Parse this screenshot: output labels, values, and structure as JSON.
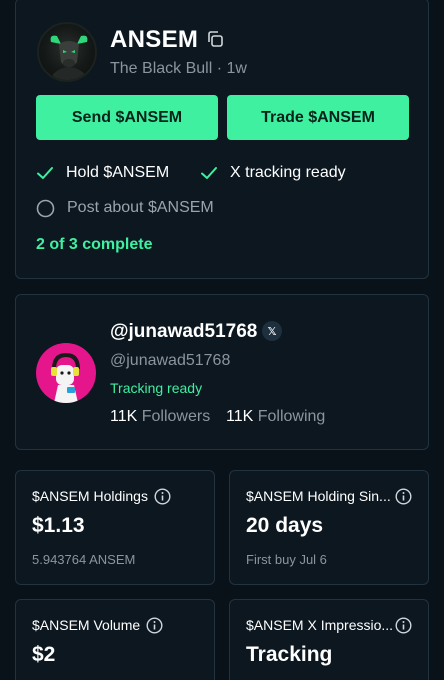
{
  "token": {
    "name": "ANSEM",
    "subtitle": "The Black Bull · 1w",
    "avatar_icon": "bull-avatar",
    "buttons": {
      "send_label": "Send $ANSEM",
      "trade_label": "Trade $ANSEM"
    },
    "tasks": [
      {
        "label": "Hold $ANSEM",
        "done": true
      },
      {
        "label": "X tracking ready",
        "done": true
      },
      {
        "label": "Post about $ANSEM",
        "done": false
      }
    ],
    "progress": "2 of 3 complete",
    "accent_color": "#3ff0a0"
  },
  "profile": {
    "handle": "@junawad51768",
    "badge": "𝕏",
    "username": "@junawad51768",
    "status": "Tracking ready",
    "followers_count": "11K",
    "followers_label": "Followers",
    "following_count": "11K",
    "following_label": "Following",
    "avatar_color": "#e5168c"
  },
  "stats": [
    {
      "label": "$ANSEM Holdings",
      "value": "$1.13",
      "sub": "5.943764 ANSEM"
    },
    {
      "label": "$ANSEM Holding Sin...",
      "value": "20 days",
      "sub": "First buy Jul 6"
    },
    {
      "label": "$ANSEM Volume",
      "value": "$2",
      "sub": ""
    },
    {
      "label": "$ANSEM X Impressio...",
      "value": "Tracking",
      "sub": ""
    }
  ]
}
